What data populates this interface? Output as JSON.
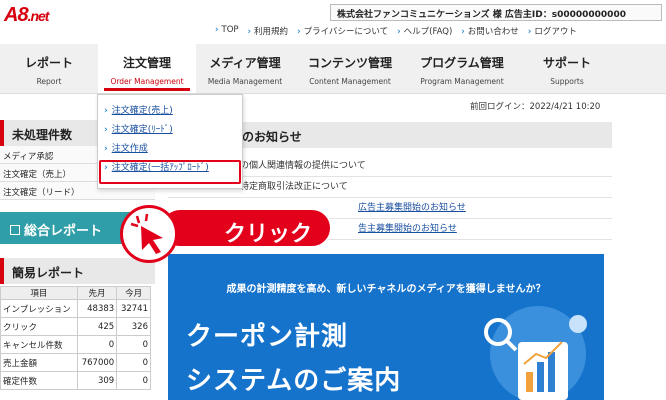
{
  "header": {
    "logo_main": "A8",
    "logo_suffix": ".net",
    "company": "株式会社ファンコミュニケーションズ 様 広告主ID：s00000000000",
    "links": [
      "TOP",
      "利用規約",
      "プライバシーについて",
      "ヘルプ(FAQ)",
      "お問い合わせ",
      "ログアウト"
    ]
  },
  "nav": [
    {
      "ja": "レポート",
      "en": "Report"
    },
    {
      "ja": "注文管理",
      "en": "Order Management"
    },
    {
      "ja": "メディア管理",
      "en": "Media Management"
    },
    {
      "ja": "コンテンツ管理",
      "en": "Content Management"
    },
    {
      "ja": "プログラム管理",
      "en": "Program Management"
    },
    {
      "ja": "サポート",
      "en": "Supports"
    }
  ],
  "dropdown": [
    "注文確定(売上)",
    "注文確定(ﾘｰﾄﾞ)",
    "注文作成",
    "注文確定(一括ｱｯﾌﾟﾛｰﾄﾞ)"
  ],
  "login_info": "前回ログイン：2022/4/21 10:20",
  "unprocessed": {
    "title": "未処理件数",
    "rows": [
      "メディア承認",
      "注文確定（売上）",
      "注文確定（リード）"
    ]
  },
  "summary_button": "総合レポート",
  "simple_report": {
    "title": "簡易レポート",
    "headers": [
      "項目",
      "先月",
      "今月"
    ],
    "rows": [
      [
        "インプレッション",
        "48383",
        "32741"
      ],
      [
        "クリック",
        "425",
        "326"
      ],
      [
        "キャンセル件数",
        "0",
        "0"
      ],
      [
        "売上金額",
        "767000",
        "0"
      ],
      [
        "確定件数",
        "309",
        "0"
      ]
    ]
  },
  "news": {
    "title": "のお知らせ",
    "items": [
      "の個人関連情報の提供について",
      "特定商取引法改正について",
      "広告主募集開始のお知らせ",
      "告主募集開始のお知らせ"
    ]
  },
  "banner": {
    "subtitle": "成果の計測精度を高め、新しいチャネルのメディアを獲得しませんか？",
    "line1": "クーポン計測",
    "line2": "システムのご案内"
  },
  "callout": "クリック",
  "colors": {
    "brand": "#d7000f",
    "banner": "#1673cc",
    "teal": "#2f9ea8"
  }
}
